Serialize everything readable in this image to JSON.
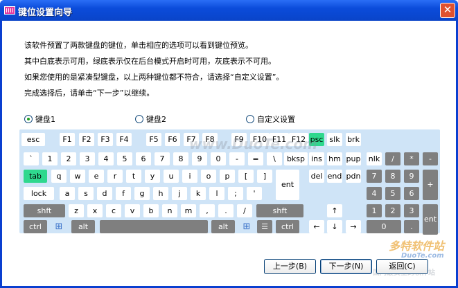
{
  "window": {
    "title": "键位设置向导"
  },
  "intro": {
    "line1": "该软件预置了两款键盘的键位，单击相应的选项可以看到键位预览。",
    "line2": "其中白底表示可用，绿底表示仅在后台模式开启时可用，灰底表示不可用。",
    "line3": "如果您使用的是紧凑型键盘，以上两种键位都不符合，请选择“自定义设置”。",
    "line4": "完成选择后，请单击“下一步”以继续。"
  },
  "options": {
    "kbd1": "键盘1",
    "kbd2": "键盘2",
    "custom": "自定义设置",
    "selected": "键盘1"
  },
  "legend_colors": {
    "available": "#ffffff",
    "background_only": "#2fd88e",
    "unavailable": "#7f7f7f"
  },
  "keyboard": {
    "row_fn": [
      "esc",
      "F1",
      "F2",
      "F3",
      "F4",
      "F5",
      "F6",
      "F7",
      "F8",
      "F9",
      "F10",
      "F11",
      "F12",
      "psc",
      "slk",
      "brk"
    ],
    "row_num": [
      "`",
      "1",
      "2",
      "3",
      "4",
      "5",
      "6",
      "7",
      "8",
      "9",
      "0",
      "-",
      "=",
      "\\",
      "bksp",
      "ins",
      "hm",
      "pup",
      "nlk",
      "/",
      "*",
      "-"
    ],
    "row_q": [
      "tab",
      "q",
      "w",
      "e",
      "r",
      "t",
      "y",
      "u",
      "i",
      "o",
      "p",
      "[",
      "]",
      "del",
      "end",
      "pdn",
      "7",
      "8",
      "9",
      "+"
    ],
    "row_a": [
      "lock",
      "a",
      "s",
      "d",
      "f",
      "g",
      "h",
      "j",
      "k",
      "l",
      ";",
      "'",
      "ent",
      "4",
      "5",
      "6"
    ],
    "row_z": [
      "shft",
      "z",
      "x",
      "c",
      "v",
      "b",
      "n",
      "m",
      ",",
      ".",
      "/",
      "shft",
      "↑",
      "1",
      "2",
      "3",
      "ent"
    ],
    "row_ctrl": [
      "ctrl",
      "alt",
      "alt",
      "ctrl",
      "←",
      "↓",
      "→",
      "0",
      "."
    ]
  },
  "buttons": {
    "back": "上一步(B)",
    "next": "下一步(N)",
    "cancel": "返回(C)"
  },
  "watermarks": {
    "site": "www.DuoTe.com",
    "brand": "多特软件站",
    "brand_url": "DuoTe.com",
    "tagline": "国内最安全的软件站"
  }
}
